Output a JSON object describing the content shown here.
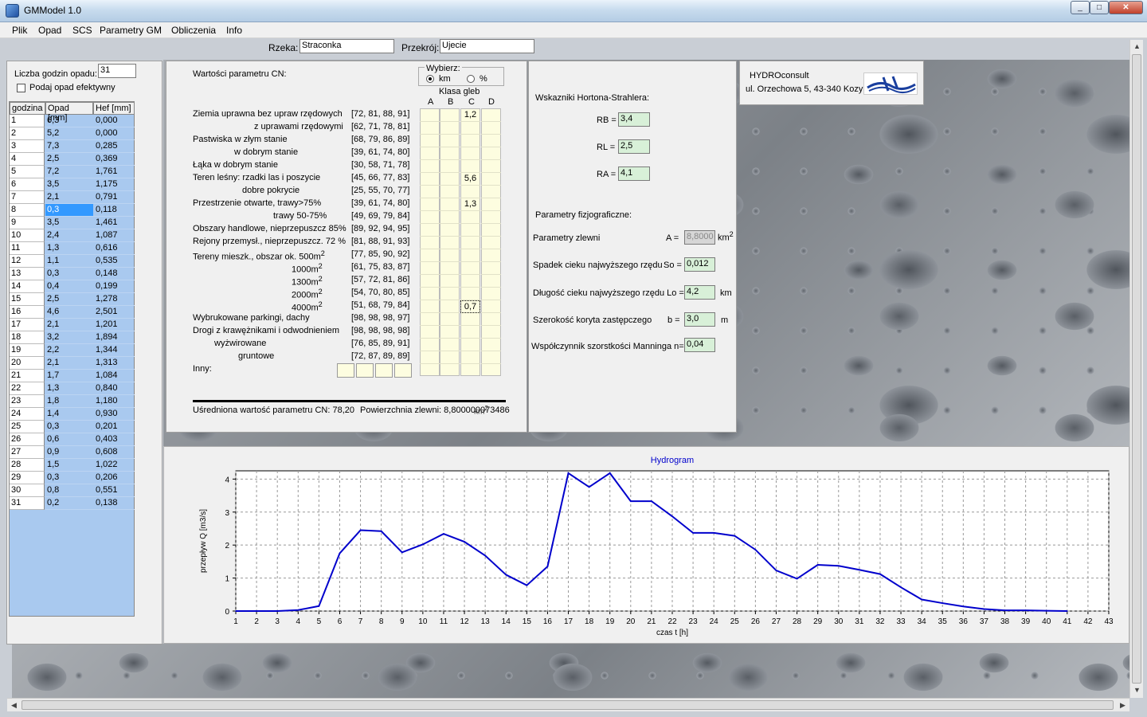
{
  "window": {
    "title": "GMModel 1.0",
    "min": "_",
    "max": "□",
    "close": "✕"
  },
  "menu": [
    "Plik",
    "Opad",
    "SCS",
    "Parametry GM",
    "Obliczenia",
    "Info"
  ],
  "header": {
    "rzeka_label": "Rzeka:",
    "rzeka_value": "Straconka",
    "przekroj_label": "Przekrój:",
    "przekroj_value": "Ujecie"
  },
  "left": {
    "hours_label": "Liczba godzin opadu:",
    "hours_value": "31",
    "checkbox_label": "Podaj opad efektywny",
    "columns": [
      "godzina",
      "Opad [mm]",
      "Hef [mm]"
    ],
    "rows": [
      [
        "1",
        "6,3",
        "0,000"
      ],
      [
        "2",
        "5,2",
        "0,000"
      ],
      [
        "3",
        "7,3",
        "0,285"
      ],
      [
        "4",
        "2,5",
        "0,369"
      ],
      [
        "5",
        "7,2",
        "1,761"
      ],
      [
        "6",
        "3,5",
        "1,175"
      ],
      [
        "7",
        "2,1",
        "0,791"
      ],
      [
        "8",
        "0,3",
        "0,118"
      ],
      [
        "9",
        "3,5",
        "1,461"
      ],
      [
        "10",
        "2,4",
        "1,087"
      ],
      [
        "11",
        "1,3",
        "0,616"
      ],
      [
        "12",
        "1,1",
        "0,535"
      ],
      [
        "13",
        "0,3",
        "0,148"
      ],
      [
        "14",
        "0,4",
        "0,199"
      ],
      [
        "15",
        "2,5",
        "1,278"
      ],
      [
        "16",
        "4,6",
        "2,501"
      ],
      [
        "17",
        "2,1",
        "1,201"
      ],
      [
        "18",
        "3,2",
        "1,894"
      ],
      [
        "19",
        "2,2",
        "1,344"
      ],
      [
        "20",
        "2,1",
        "1,313"
      ],
      [
        "21",
        "1,7",
        "1,084"
      ],
      [
        "22",
        "1,3",
        "0,840"
      ],
      [
        "23",
        "1,8",
        "1,180"
      ],
      [
        "24",
        "1,4",
        "0,930"
      ],
      [
        "25",
        "0,3",
        "0,201"
      ],
      [
        "26",
        "0,6",
        "0,403"
      ],
      [
        "27",
        "0,9",
        "0,608"
      ],
      [
        "28",
        "1,5",
        "1,022"
      ],
      [
        "29",
        "0,3",
        "0,206"
      ],
      [
        "30",
        "0,8",
        "0,551"
      ],
      [
        "31",
        "0,2",
        "0,138"
      ]
    ]
  },
  "cn": {
    "title": "Wartości parametru CN:",
    "wybierz": "Wybierz:",
    "opt_km": "km",
    "opt_pct": "%",
    "klasa": "Klasa gleb",
    "soil_classes": [
      "A",
      "B",
      "C",
      "D"
    ],
    "rows": [
      {
        "label": "Ziemia uprawna bez upraw rzędowych",
        "values": "[72, 81, 88, 91]",
        "c": "1,2"
      },
      {
        "label": "z uprawami rzędowymi",
        "values": "[62, 71, 78, 81]",
        "c": ""
      },
      {
        "label": "Pastwiska w złym stanie",
        "values": "[68, 79, 86, 89]",
        "c": ""
      },
      {
        "label": "w dobrym stanie",
        "values": "[39, 61, 74, 80]",
        "c": ""
      },
      {
        "label": "Łąka w dobrym stanie",
        "values": "[30, 58, 71, 78]",
        "c": ""
      },
      {
        "label": "Teren leśny: rzadki las i poszycie",
        "values": "[45, 66, 77, 83]",
        "c": "5,6"
      },
      {
        "label": "dobre pokrycie",
        "values": "[25, 55, 70, 77]",
        "c": ""
      },
      {
        "label": "Przestrzenie otwarte, trawy>75%",
        "values": "[39, 61, 74, 80]",
        "c": "1,3"
      },
      {
        "label": "trawy 50-75%",
        "values": "[49, 69, 79, 84]",
        "c": ""
      },
      {
        "label": "Obszary handlowe, nieprzepuszcz 85%",
        "values": "[89, 92, 94, 95]",
        "c": ""
      },
      {
        "label": "Rejony przemysł., nieprzepuszcz. 72 %",
        "values": "[81, 88, 91, 93]",
        "c": ""
      },
      {
        "label": "Tereny mieszk., obszar ok. 500m",
        "sup": "2",
        "values": "[77, 85, 90, 92]",
        "c": ""
      },
      {
        "label": "1000m",
        "sup": "2",
        "values": "[61, 75, 83, 87]",
        "c": ""
      },
      {
        "label": "1300m",
        "sup": "2",
        "values": "[57, 72, 81, 86]",
        "c": ""
      },
      {
        "label": "2000m",
        "sup": "2",
        "values": "[54, 70, 80, 85]",
        "c": ""
      },
      {
        "label": "4000m",
        "sup": "2",
        "values": "[51, 68, 79, 84]",
        "c": "0,7"
      },
      {
        "label": "Wybrukowane parkingi, dachy",
        "values": "[98, 98, 98, 97]",
        "c": ""
      },
      {
        "label": "Drogi z krawężnikami i odwodnieniem",
        "values": "[98, 98, 98, 98]",
        "c": ""
      },
      {
        "label": "wyżwirowane",
        "values": "[76, 85, 89, 91]",
        "c": ""
      },
      {
        "label": "gruntowe",
        "values": "[72, 87, 89, 89]",
        "c": ""
      }
    ],
    "inny": "Inny:",
    "avg": "Uśredniona wartość parametru CN: 78,20",
    "area": "Powierzchnia zlewni:  8,800000073486",
    "area_unit": "km",
    "area_sup": "2"
  },
  "params": {
    "horton": "Wskazniki Hortona-Strahlera:",
    "rb_label": "RB =",
    "rb": "3,4",
    "rl_label": "RL =",
    "rl": "2,5",
    "ra_label": "RA =",
    "ra": "4,1",
    "fizjo": "Parametry fizjograficzne:",
    "zlewnia": "Parametry zlewni",
    "a_label": "A =",
    "a": "8,8000",
    "a_unit": "km",
    "a_sup": "2",
    "spadek": "Spadek cieku najwyższego rzędu",
    "so_label": "So =",
    "so": "0,012",
    "dlugosc": "Długość cieku najwyższego rzędu Lo =",
    "lo": "4,2",
    "lo_unit": "km",
    "szer": "Szerokość koryta zastępczego",
    "b_label": "b =",
    "b": "3,0",
    "b_unit": "m",
    "manning": "Współczynnik szorstkości Manninga n=",
    "n": "0,04"
  },
  "company": {
    "name": "HYDROconsult",
    "address": "ul. Orzechowa 5, 43-340 Kozy"
  },
  "chart_data": {
    "type": "line",
    "title": "Hydrogram",
    "xlabel": "czas t [h]",
    "ylabel": "przepływ Q [m3/s]",
    "xlim": [
      1,
      43
    ],
    "ylim": [
      0,
      4.25
    ],
    "x_ticks": [
      1,
      2,
      3,
      4,
      5,
      6,
      7,
      8,
      9,
      10,
      11,
      12,
      13,
      14,
      15,
      16,
      17,
      18,
      19,
      20,
      21,
      22,
      23,
      24,
      25,
      26,
      27,
      28,
      29,
      30,
      31,
      32,
      33,
      34,
      35,
      36,
      37,
      38,
      39,
      40,
      41,
      42,
      43
    ],
    "y_ticks": [
      0,
      1,
      2,
      3,
      4
    ],
    "grid": true,
    "color": "#0000cc",
    "series": [
      {
        "x": [
          1,
          2,
          3,
          4,
          5,
          6,
          7,
          8,
          9,
          10,
          11,
          12,
          13,
          14,
          15,
          16,
          17,
          18,
          19,
          20,
          21,
          22,
          23,
          24,
          25,
          26,
          27,
          28,
          29,
          30,
          31,
          32,
          33,
          34,
          35,
          36,
          37,
          38,
          39,
          40,
          41
        ],
        "values": [
          0,
          0,
          0,
          0.03,
          0.15,
          1.75,
          2.45,
          2.42,
          1.78,
          2.02,
          2.34,
          2.1,
          1.68,
          1.1,
          0.78,
          1.35,
          4.18,
          3.76,
          4.18,
          3.33,
          3.33,
          2.87,
          2.37,
          2.37,
          2.28,
          1.86,
          1.23,
          0.98,
          1.4,
          1.37,
          1.25,
          1.12,
          0.72,
          0.35,
          0.24,
          0.14,
          0.06,
          0.02,
          0.02,
          0.01,
          0.0
        ]
      }
    ]
  }
}
